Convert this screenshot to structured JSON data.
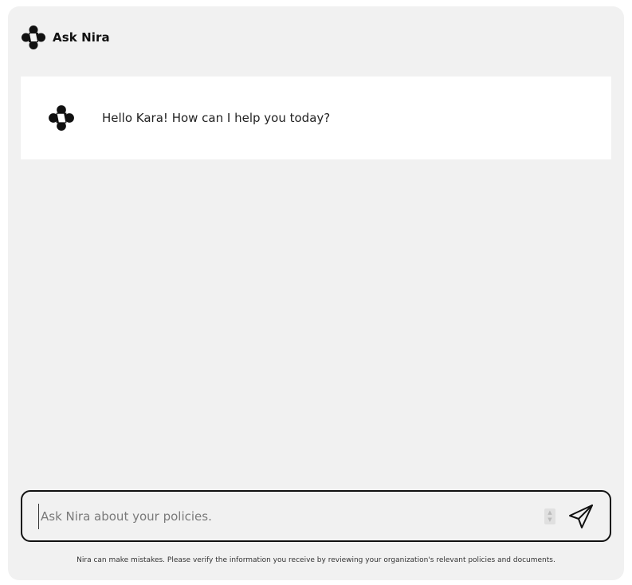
{
  "header": {
    "title": "Ask Nira",
    "logo_icon": "nira-logo-icon"
  },
  "chat": {
    "messages": [
      {
        "sender": "assistant",
        "avatar_icon": "nira-logo-icon",
        "text": "Hello Kara! How can I help you today?"
      }
    ]
  },
  "composer": {
    "value": "",
    "placeholder": "Ask Nira about your policies.",
    "send_icon": "paper-plane-icon",
    "spinner_icon": "spinner-arrows-icon"
  },
  "footer": {
    "disclaimer": "Nira can make mistakes. Please verify the information you receive by reviewing your organization's relevant policies and documents."
  },
  "colors": {
    "panel_bg": "#f1f1f1",
    "message_bg": "#ffffff",
    "text": "#222222",
    "border": "#111111"
  }
}
